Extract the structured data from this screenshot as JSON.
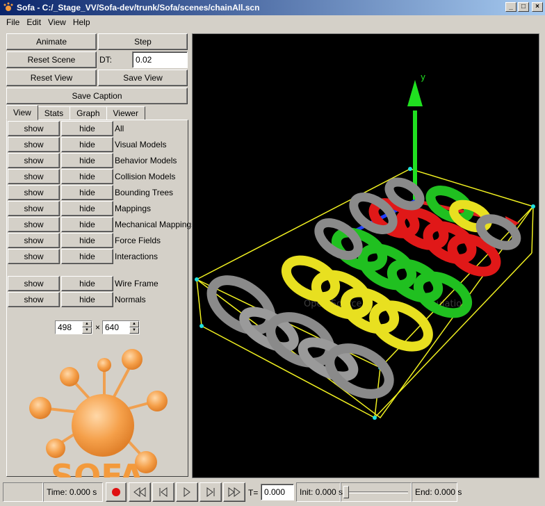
{
  "window": {
    "title": "Sofa - C:/_Stage_VV/Sofa-dev/trunk/Sofa/scenes/chainAll.scn",
    "buttons": [
      "_",
      "□",
      "×"
    ]
  },
  "menu": [
    "File",
    "Edit",
    "View",
    "Help"
  ],
  "controls": {
    "animate": "Animate",
    "step": "Step",
    "reset_scene": "Reset Scene",
    "dt_label": "DT:",
    "dt_value": "0.02",
    "reset_view": "Reset View",
    "save_view": "Save View",
    "save_caption": "Save Caption"
  },
  "tabs": [
    "View",
    "Stats",
    "Graph",
    "Viewer"
  ],
  "visibility_rows": [
    {
      "show": "show",
      "hide": "hide",
      "label": "All"
    },
    {
      "show": "show",
      "hide": "hide",
      "label": "Visual Models"
    },
    {
      "show": "show",
      "hide": "hide",
      "label": "Behavior Models"
    },
    {
      "show": "show",
      "hide": "hide",
      "label": "Collision Models"
    },
    {
      "show": "show",
      "hide": "hide",
      "label": "Bounding Trees"
    },
    {
      "show": "show",
      "hide": "hide",
      "label": "Mappings"
    },
    {
      "show": "show",
      "hide": "hide",
      "label": "Mechanical Mappings"
    },
    {
      "show": "show",
      "hide": "hide",
      "label": "Force Fields"
    },
    {
      "show": "show",
      "hide": "hide",
      "label": "Interactions"
    },
    {
      "show": "show",
      "hide": "hide",
      "label": "Wire Frame"
    },
    {
      "show": "show",
      "hide": "hide",
      "label": "Normals"
    }
  ],
  "size": {
    "width": "498",
    "times": "×",
    "height": "640"
  },
  "logo": {
    "text": "SOFA",
    "color": "#f39a3c"
  },
  "viewport": {
    "watermark_left": "Open Source",
    "watermark_right": "mulation",
    "axis_label": "y"
  },
  "statusbar": {
    "time": "Time: 0.000 s",
    "t_label": "T=",
    "t_value": "0.000",
    "init": "Init: 0.000 s",
    "end": "End: 0.000 s",
    "record_color": "#e01010"
  }
}
